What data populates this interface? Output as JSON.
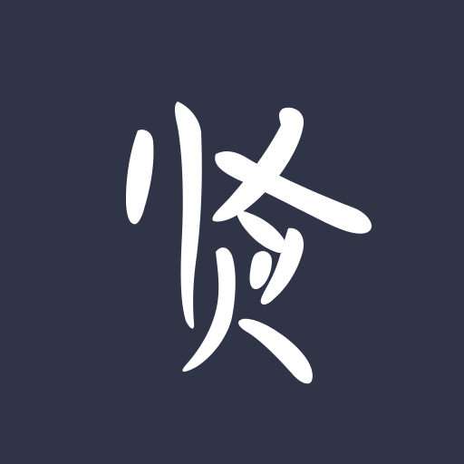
{
  "logo": {
    "character": "贤",
    "background_color": "#2f3446",
    "glyph_color": "#ffffff"
  }
}
